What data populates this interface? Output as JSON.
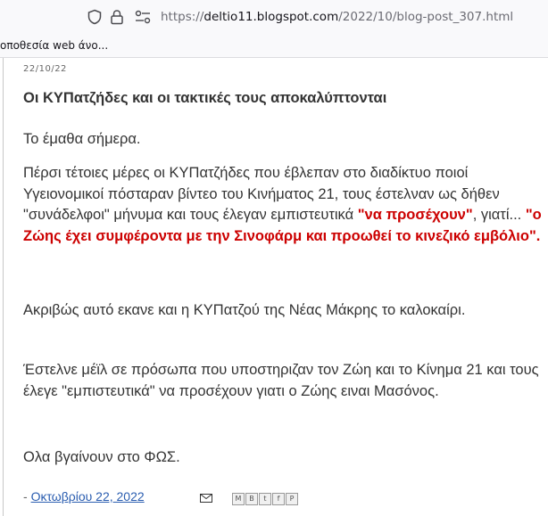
{
  "browser": {
    "url_prefix": "https://",
    "url_host": "deltio11.blogspot.com",
    "url_path": "/2022/10/blog-post_307.html",
    "bookmark_label": "οποθεσία web άνο..."
  },
  "post": {
    "date_header": "22/10/22",
    "title": "Οι ΚΥΠατζήδες και οι τακτικές τους αποκαλύπτονται",
    "p1": "Το έμαθα σήμερα.",
    "p2_a": "Πέρσι τέτοιες μέρες οι ΚΥΠατζήδες που έβλεπαν στο διαδίκτυο ποιοί Υγειονομικοί  πόσταραν βίντεο του Κινήματος 21, τους έστελναν ως δήθεν \"συνάδελφοι\" μήνυμα και τους έλεγαν εμπιστευτικά ",
    "p2_red1": "\"να προσέχουν\"",
    "p2_b": ", γιατί... ",
    "p2_red2": "\"ο Ζώης έχει συμφέροντα με την Σινοφάρμ και προωθεί το κινεζικό εμβόλιο\".",
    "p3": "Ακριβώς αυτό εκανε και η ΚΥΠατζού της Νέας Μάκρης το καλοκαίρι.",
    "p4": "Έστελνε μέϊλ σε πρόσωπα που υποστηριζαν τον Ζώη και το Κίνημα 21 και τους έλεγε \"εμπιστευτικά\" να προσέχουν γιατι ο Ζώης ειναι Μασόνος.",
    "p5": "Ολα βγαίνουν στο ΦΩΣ.",
    "footer_dash": "- ",
    "footer_date": "Οκτωβρίου 22, 2022"
  },
  "share_buttons": [
    "M",
    "B",
    "t",
    "f",
    "P"
  ],
  "colors": {
    "accent_red": "#cc0000",
    "link": "#2a5db0",
    "text": "#333333"
  }
}
